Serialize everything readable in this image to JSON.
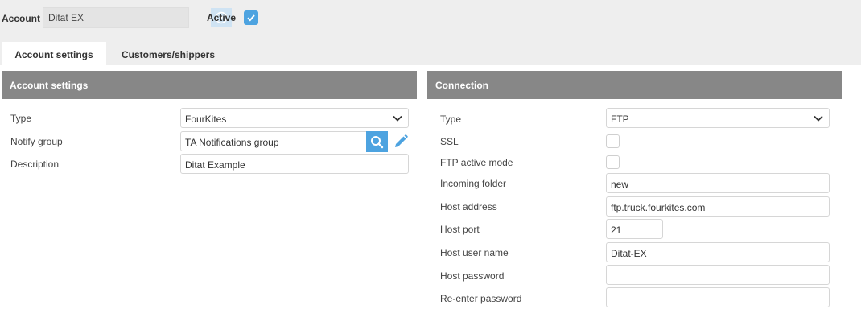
{
  "header": {
    "account_label": "Account",
    "account_value": "Ditat EX",
    "active_label": "Active",
    "active_checked": true
  },
  "tabs": [
    {
      "label": "Account settings",
      "active": true
    },
    {
      "label": "Customers/shippers",
      "active": false
    }
  ],
  "account_settings": {
    "title": "Account settings",
    "type_label": "Type",
    "type_value": "FourKites",
    "notify_group_label": "Notify group",
    "notify_group_value": "TA Notifications group",
    "description_label": "Description",
    "description_value": "Ditat Example"
  },
  "connection": {
    "title": "Connection",
    "type_label": "Type",
    "type_value": "FTP",
    "ssl_label": "SSL",
    "ssl_checked": false,
    "ftp_active_mode_label": "FTP active mode",
    "ftp_active_mode_checked": false,
    "incoming_folder_label": "Incoming folder",
    "incoming_folder_value": "new",
    "host_address_label": "Host address",
    "host_address_value": "ftp.truck.fourkites.com",
    "host_port_label": "Host port",
    "host_port_value": "21",
    "host_user_name_label": "Host user name",
    "host_user_name_value": "Ditat-EX",
    "host_password_label": "Host password",
    "host_password_value": "",
    "reenter_password_label": "Re-enter password",
    "reenter_password_value": ""
  },
  "colors": {
    "accent": "#4da3e0",
    "panel_header": "#878787",
    "topbar": "#eeeeee"
  },
  "icons": {
    "account_lookup": "compass-icon",
    "active_check": "checkmark-icon",
    "dropdown": "chevron-down-icon",
    "search": "search-icon",
    "edit": "pencil-icon"
  }
}
